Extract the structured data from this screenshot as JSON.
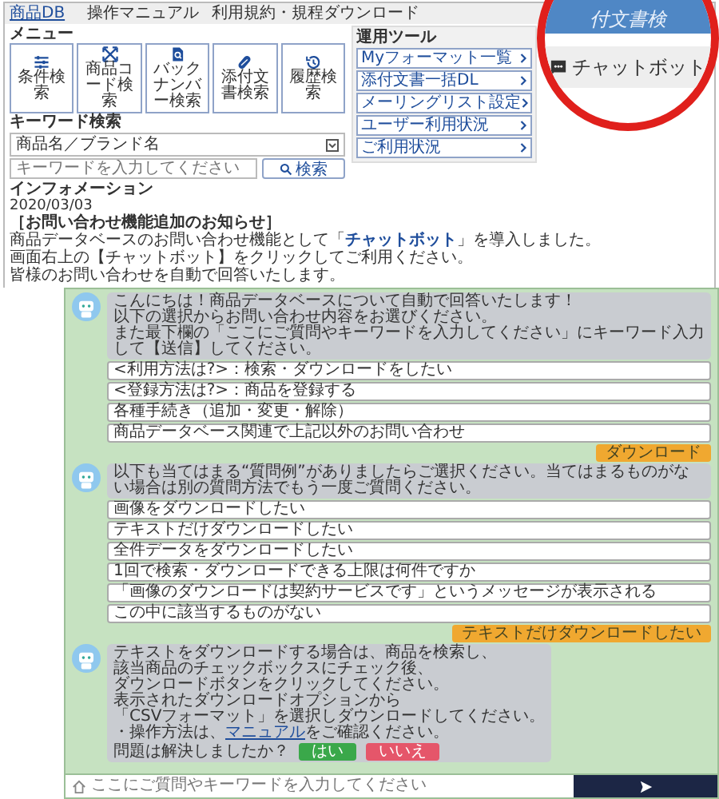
{
  "site": {
    "logo": "商品DB",
    "nav_links": [
      "操作マニュアル",
      "利用規約・規程ダウンロード"
    ],
    "menu_title": "メニュー",
    "menu_tiles": [
      {
        "kind": "sliders",
        "label": "条件検索"
      },
      {
        "kind": "arrows",
        "label": "商品コード検索"
      },
      {
        "kind": "document",
        "label": "バックナンバー検索"
      },
      {
        "kind": "pill",
        "label": "添付文書検索"
      },
      {
        "kind": "history",
        "label": "履歴検索"
      }
    ],
    "sidebar": {
      "title": "運用ツール",
      "items": [
        "Myフォーマット一覧",
        "添付文書一括DL",
        "メーリングリスト設定",
        "ユーザー利用状況",
        "ご利用状況"
      ]
    },
    "keyword": {
      "title": "キーワード検索",
      "select": "商品名／ブランド名",
      "placeholder": "キーワードを入力してください",
      "button": "検索"
    },
    "info": {
      "title": "インフォメーション",
      "date": "2020/03/03",
      "heading": "［お問い合わせ機能追加のお知らせ］",
      "lines": [
        "商品データベースのお問い合わせ機能として「**チャットボット**」を導入しました。",
        "画面右上の【チャットボット】をクリックしてご利用ください。",
        "皆様のお問い合わせを自動で回答いたします。"
      ]
    }
  },
  "zoom": {
    "band_text": "付文書検",
    "button": "チャットボット"
  },
  "chat": {
    "messages": [
      {
        "kind": "bot",
        "lines": [
          {
            "text": "こんにちは！商品データベースについて自動で回答いたします！"
          },
          {
            "text": "以下の選択からお問い合わせ内容をお選びください。"
          },
          {
            "text": "また最下欄の「ここにご質問やキーワードを入力してください」にキーワード入力して【送信】してください。"
          }
        ],
        "options": [
          "<利用方法は?>：検索・ダウンロードをしたい",
          "<登録方法は?>：商品を登録する",
          "各種手続き（追加・変更・解除）",
          "商品データベース関連で上記以外のお問い合わせ"
        ]
      },
      {
        "kind": "user",
        "text": "ダウンロード"
      },
      {
        "kind": "bot",
        "lines": [
          {
            "text": "以下も当てはまる“質問例”がありましたらご選択ください。当てはまるものがない場合は別の質問方法でもう一度ご質問ください。"
          }
        ],
        "options": [
          "画像をダウンロードしたい",
          "テキストだけダウンロードしたい",
          "全件データをダウンロードしたい",
          "1回で検索・ダウンロードできる上限は何件ですか",
          "「画像のダウンロードは契約サービスです」というメッセージが表示される",
          "この中に該当するものがない"
        ]
      },
      {
        "kind": "user",
        "text": "テキストだけダウンロードしたい"
      },
      {
        "kind": "bot",
        "lines": [
          {
            "text": "テキストをダウンロードする場合は、商品を検索し、"
          },
          {
            "text": "該当商品のチェックボックスにチェック後、"
          },
          {
            "text": "ダウンロードボタンをクリックしてください。"
          },
          {
            "text": "表示されたダウンロードオプションから"
          },
          {
            "text": "「CSVフォーマット」を選択しダウンロードしてください。"
          },
          {
            "text": "・操作方法は、",
            "link": "マニュアル",
            "after": "をご確認ください。"
          }
        ],
        "question": "問題は解決しましたか？",
        "yes": "はい",
        "no": "いいえ"
      }
    ],
    "input_placeholder": "ここにご質問やキーワードを入力してください"
  }
}
